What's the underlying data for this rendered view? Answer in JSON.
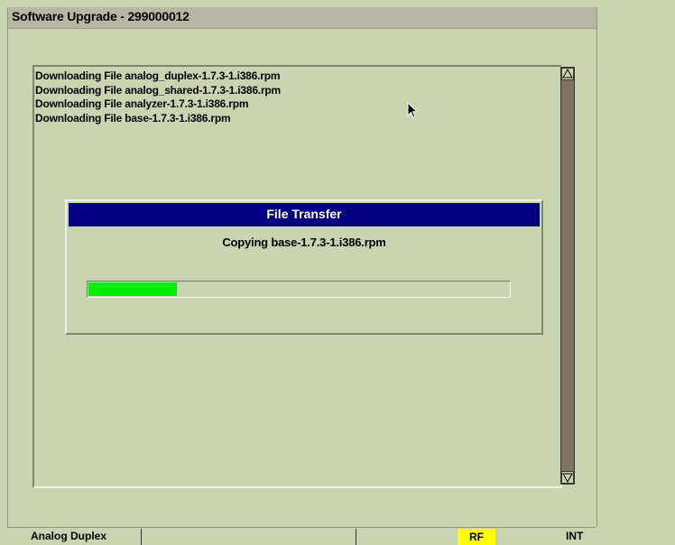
{
  "window": {
    "title": "Software Upgrade - 299000012"
  },
  "log": {
    "lines": [
      "Downloading File analog_duplex-1.7.3-1.i386.rpm",
      "Downloading File analog_shared-1.7.3-1.i386.rpm",
      "Downloading File analyzer-1.7.3-1.i386.rpm",
      "Downloading File base-1.7.3-1.i386.rpm"
    ]
  },
  "dialog": {
    "title": "File Transfer",
    "message": "Copying base-1.7.3-1.i386.rpm",
    "progress_fraction": 0.21
  },
  "statusbar": {
    "mode": "Analog Duplex",
    "rf": "RF",
    "int": "INT"
  },
  "colors": {
    "background": "#c8d5b0",
    "titlebar": "#b8b8a2",
    "dialog_title": "#000080",
    "progress": "#00ee00",
    "rf_badge": "#ffff00",
    "scrollbar_track": "#7c7460"
  },
  "icons": {
    "scroll_up": "up-arrow-icon",
    "scroll_down": "down-arrow-icon",
    "cursor": "mouse-pointer-icon"
  }
}
